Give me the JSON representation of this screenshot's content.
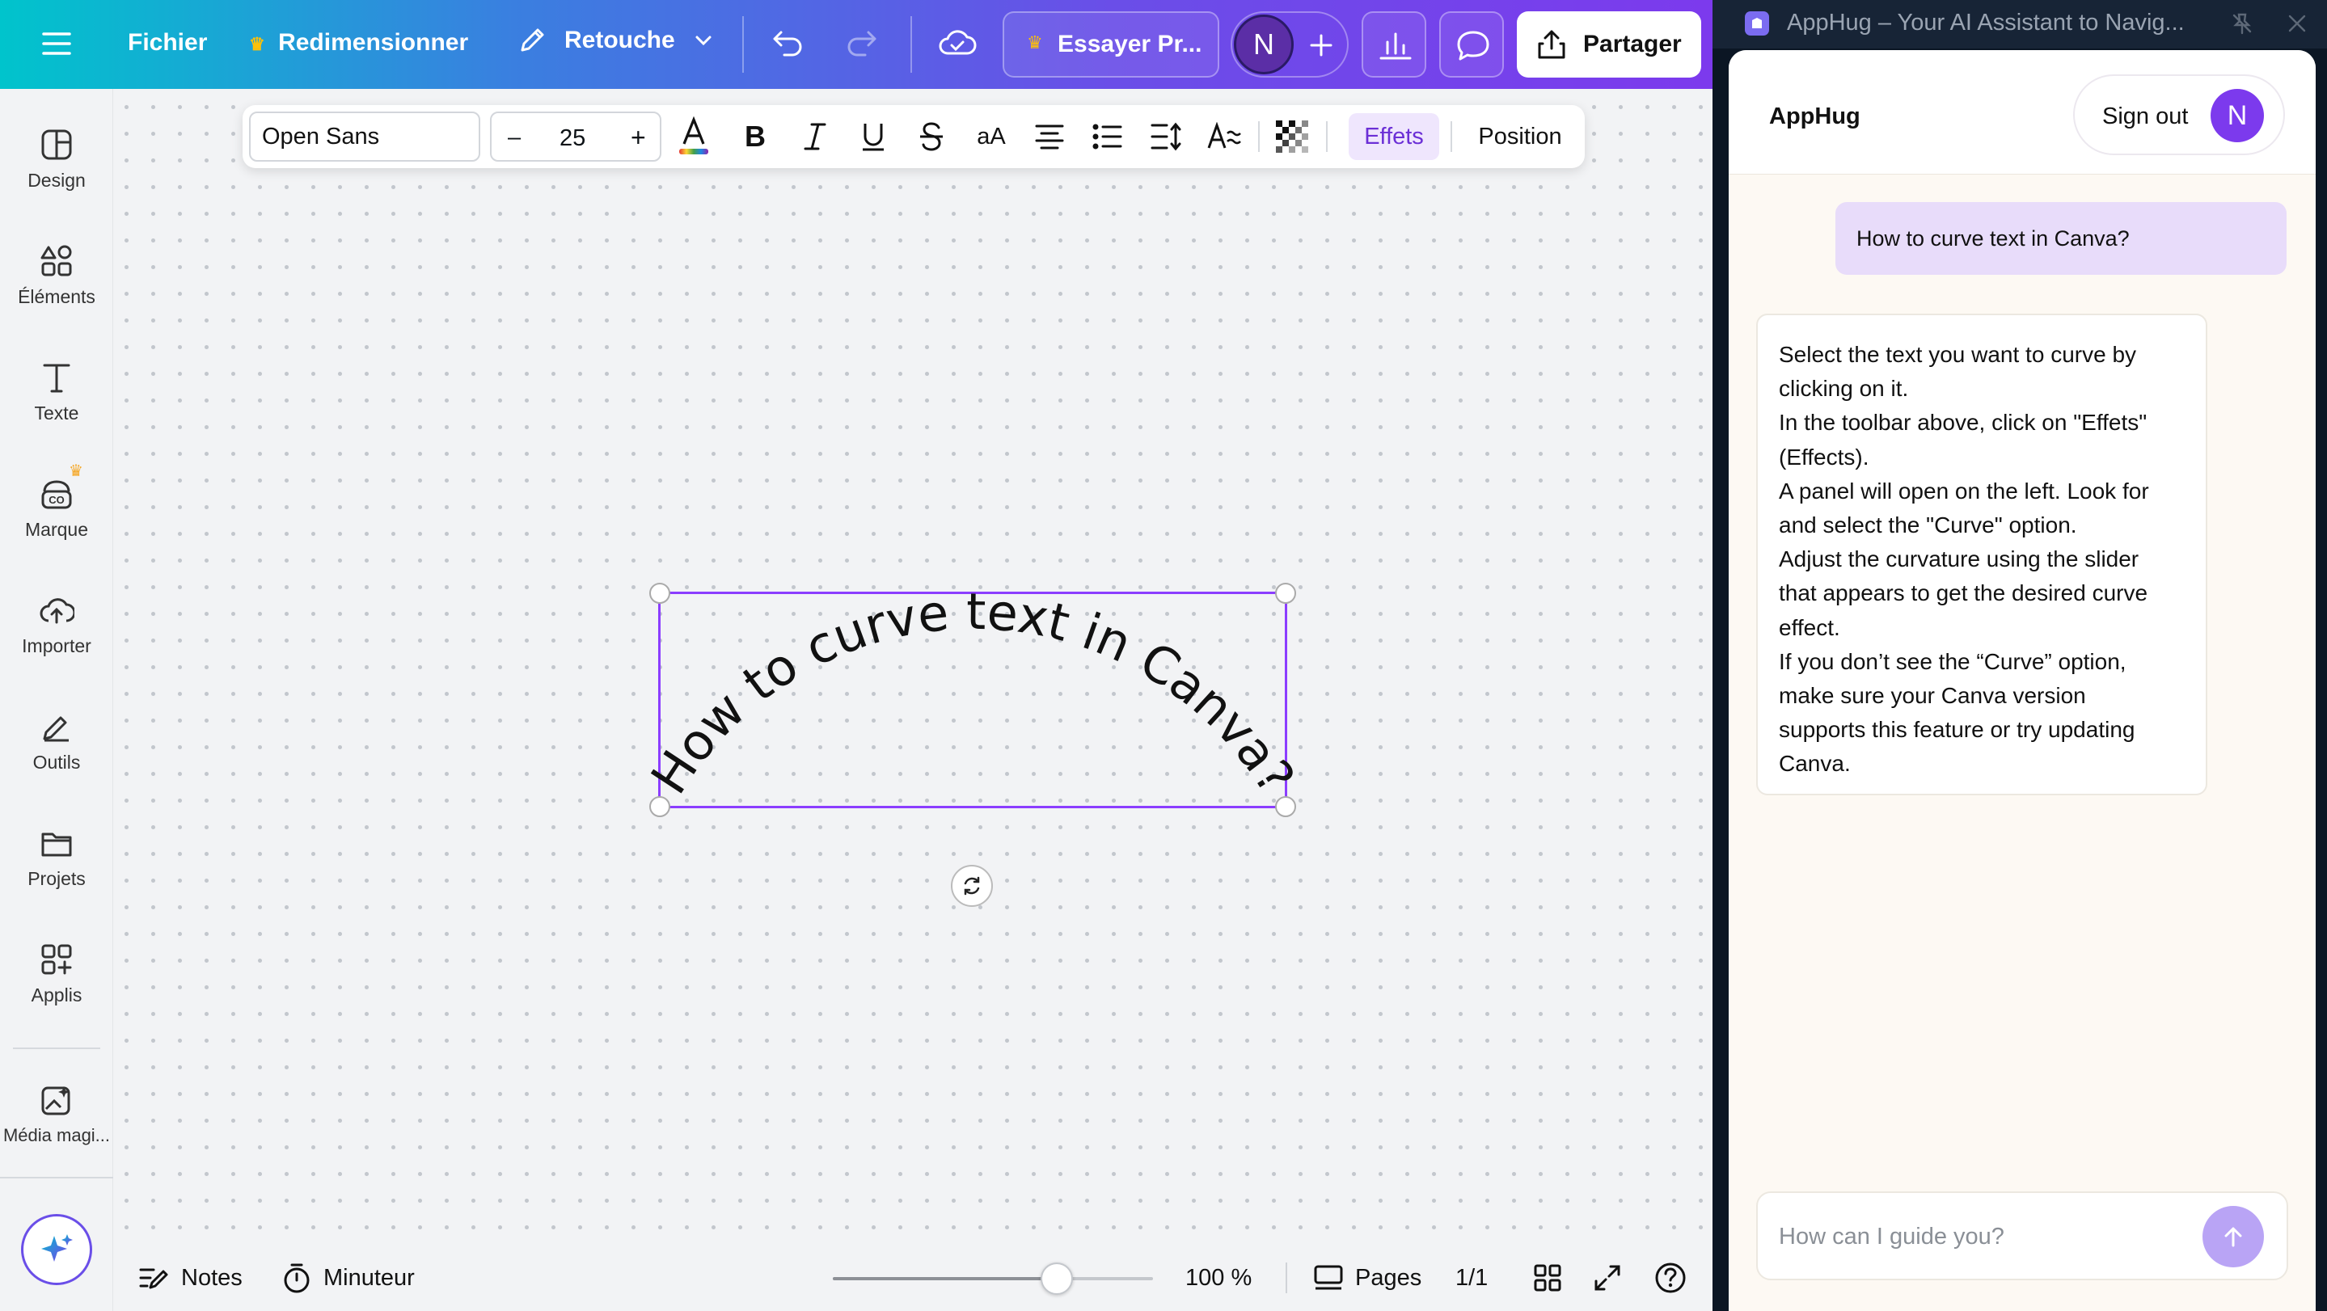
{
  "app": {
    "menu_label": "Fichier",
    "resize_label": "Redimensionner",
    "edit_label": "Retouche",
    "try_pro_label": "Essayer Pr...",
    "avatar_letter": "N",
    "share_label": "Partager"
  },
  "sidebar": {
    "items": [
      {
        "label": "Design",
        "icon": "design-icon"
      },
      {
        "label": "Éléments",
        "icon": "elements-icon"
      },
      {
        "label": "Texte",
        "icon": "text-icon"
      },
      {
        "label": "Marque",
        "icon": "brand-icon"
      },
      {
        "label": "Importer",
        "icon": "upload-icon"
      },
      {
        "label": "Outils",
        "icon": "tools-icon"
      },
      {
        "label": "Projets",
        "icon": "folder-icon"
      },
      {
        "label": "Applis",
        "icon": "apps-icon"
      },
      {
        "label": "Média magi...",
        "icon": "magic-media-icon"
      }
    ]
  },
  "text_toolbar": {
    "font_name": "Open Sans",
    "font_size": "25",
    "minus": "–",
    "plus": "+",
    "case_label": "aA",
    "effects_label": "Effets",
    "position_label": "Position"
  },
  "canvas": {
    "curved_text": "How to curve text in Canva?"
  },
  "bottom_bar": {
    "notes_label": "Notes",
    "timer_label": "Minuteur",
    "zoom_value": 0.7,
    "zoom_label": "100 %",
    "pages_label": "Pages",
    "page_count": "1/1"
  },
  "assistant": {
    "window_title": "AppHug – Your AI Assistant to Navig...",
    "brand": "AppHug",
    "sign_out_label": "Sign out",
    "avatar_letter": "N",
    "user_message": "How to curve text in Canva?",
    "reply_lines": [
      "Select the text you want to curve by",
      "clicking on it.",
      "In the toolbar above, click on \"Effets\"",
      "(Effects).",
      "A panel will open on the left. Look for",
      "and select the \"Curve\" option.",
      "Adjust the curvature using the slider",
      "that appears to get the desired curve",
      "effect.",
      "If you don’t see the “Curve” option,",
      "make sure your Canva version",
      "supports this feature or try updating",
      "Canva."
    ],
    "input_placeholder": "How can I guide you?"
  },
  "colors": {
    "accent_purple": "#7c3aed",
    "selection": "#8b3dff",
    "effects_bg": "#efe6fd",
    "user_bubble": "#e8dcfa",
    "send_button": "#b9a4f5"
  }
}
